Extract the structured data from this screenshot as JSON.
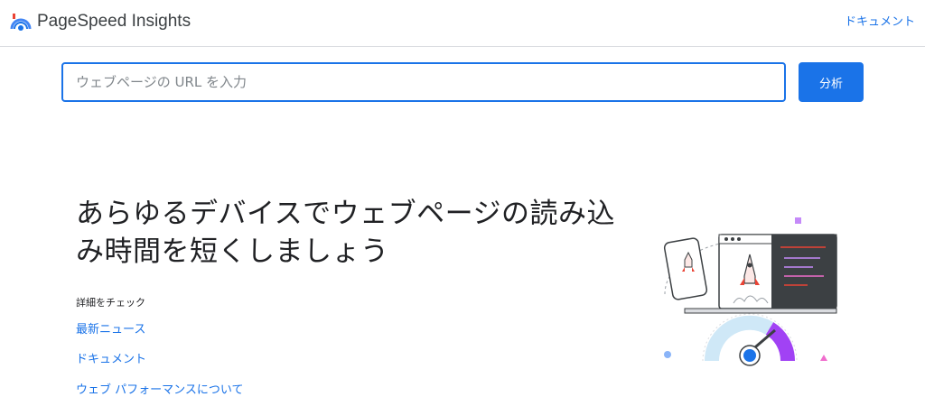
{
  "header": {
    "brand": "PageSpeed Insights",
    "doc_link": "ドキュメント"
  },
  "search": {
    "placeholder": "ウェブページの URL を入力",
    "value": "",
    "analyze_label": "分析"
  },
  "main": {
    "headline": "あらゆるデバイスでウェブページの読み込み時間を短くしましょう",
    "learn_more_label": "詳細をチェック",
    "links": [
      "最新ニュース",
      "ドキュメント",
      "ウェブ パフォーマンスについて"
    ]
  },
  "colors": {
    "accent": "#1a73e8",
    "gauge_good": "#cfe8f7",
    "gauge_poor": "#a142f4"
  },
  "icons": {
    "logo": "pagespeed-gauge-logo",
    "illustration": "devices-rocket-gauge-illustration"
  }
}
